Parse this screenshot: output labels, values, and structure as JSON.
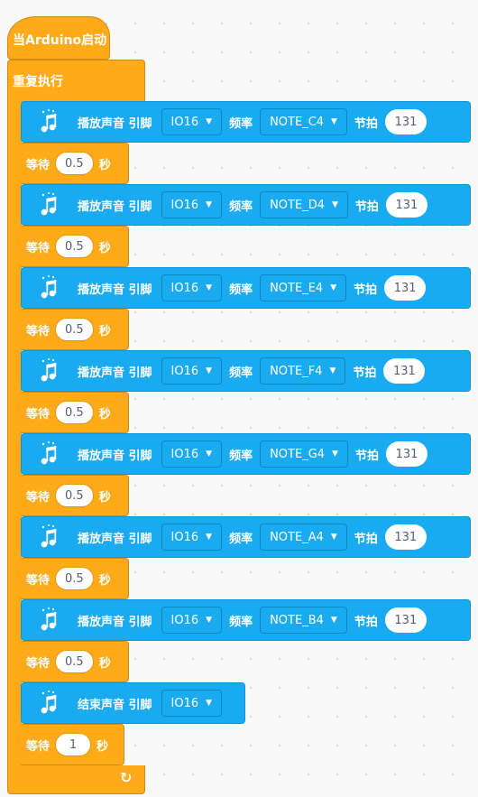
{
  "when_start": {
    "label": "当Arduino启动"
  },
  "forever": {
    "label": "重复执行",
    "loop_icon": "loop-arrow-icon"
  },
  "colors": {
    "events": "#ffab19",
    "sound": "#1aaaf0"
  },
  "play_label": "播放声音 引脚",
  "freq_label": "频率",
  "beat_label": "节拍",
  "wait_label": "等待",
  "sec_label": "秒",
  "notes": [
    {
      "pin": "IO16",
      "note": "NOTE_C4",
      "beat": "131",
      "wait": "0.5"
    },
    {
      "pin": "IO16",
      "note": "NOTE_D4",
      "beat": "131",
      "wait": "0.5"
    },
    {
      "pin": "IO16",
      "note": "NOTE_E4",
      "beat": "131",
      "wait": "0.5"
    },
    {
      "pin": "IO16",
      "note": "NOTE_F4",
      "beat": "131",
      "wait": "0.5"
    },
    {
      "pin": "IO16",
      "note": "NOTE_G4",
      "beat": "131",
      "wait": "0.5"
    },
    {
      "pin": "IO16",
      "note": "NOTE_A4",
      "beat": "131",
      "wait": "0.5"
    },
    {
      "pin": "IO16",
      "note": "NOTE_B4",
      "beat": "131",
      "wait": "0.5"
    }
  ],
  "stop_block": {
    "label": "结束声音 引脚",
    "pin": "IO16"
  },
  "final_wait": {
    "value": "1"
  }
}
